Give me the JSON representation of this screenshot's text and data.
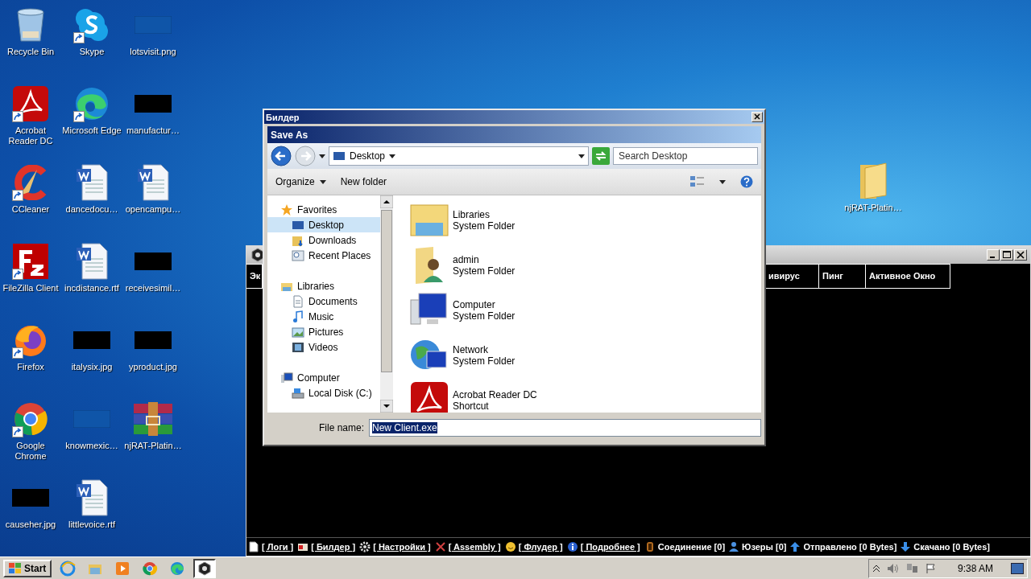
{
  "desktop_icons": [
    {
      "label": "Recycle Bin",
      "kind": "recycle",
      "shortcut": false
    },
    {
      "label": "Skype",
      "kind": "skype",
      "shortcut": true
    },
    {
      "label": "lotsvisit.png",
      "kind": "blank-image",
      "shortcut": false
    },
    {
      "label": "Acrobat Reader DC",
      "kind": "acrobat",
      "shortcut": true
    },
    {
      "label": "Microsoft Edge",
      "kind": "edge",
      "shortcut": true
    },
    {
      "label": "manufactur…",
      "kind": "dark-image",
      "shortcut": false
    },
    {
      "label": "CCleaner",
      "kind": "ccleaner",
      "shortcut": true
    },
    {
      "label": "dancedocu…",
      "kind": "word",
      "shortcut": false
    },
    {
      "label": "opencampu…",
      "kind": "word",
      "shortcut": false
    },
    {
      "label": "FileZilla Client",
      "kind": "filezilla",
      "shortcut": true
    },
    {
      "label": "incdistance.rtf",
      "kind": "word",
      "shortcut": false
    },
    {
      "label": "receivesimil…",
      "kind": "dark-image",
      "shortcut": false
    },
    {
      "label": "Firefox",
      "kind": "firefox",
      "shortcut": true
    },
    {
      "label": "italysix.jpg",
      "kind": "dark-image",
      "shortcut": false
    },
    {
      "label": "yproduct.jpg",
      "kind": "dark-image",
      "shortcut": false
    },
    {
      "label": "Google Chrome",
      "kind": "chrome",
      "shortcut": true
    },
    {
      "label": "knowmexic…",
      "kind": "blank-image",
      "shortcut": false
    },
    {
      "label": "njRAT-Platin…",
      "kind": "winrar",
      "shortcut": false
    },
    {
      "label": "causeher.jpg",
      "kind": "dark-image",
      "shortcut": false
    },
    {
      "label": "littlevoice.rtf",
      "kind": "word",
      "shortcut": false
    }
  ],
  "desktop_side_icons": [
    {
      "label": "njRAT-Platin…",
      "kind": "folder",
      "shortcut": false
    }
  ],
  "njrat_window": {
    "columns": [
      "Эк",
      "ивирус",
      "Пинг",
      "Активное Окно"
    ],
    "status_links": [
      {
        "kind": "log",
        "label": "[ Логи ]"
      },
      {
        "kind": "builder",
        "label": "[ Билдер ]"
      },
      {
        "kind": "settings",
        "label": "[ Настройки ]"
      },
      {
        "kind": "assembly",
        "label": "[ Assembly ]"
      },
      {
        "kind": "flooder",
        "label": "[ Флудер ]"
      },
      {
        "kind": "info",
        "label": "[ Подробнее ]"
      }
    ],
    "status_counters": [
      {
        "kind": "connection",
        "label": "Соединение [0]"
      },
      {
        "kind": "users",
        "label": "Юзеры [0]"
      },
      {
        "kind": "upload",
        "label": "Отправлено [0 Bytes]"
      },
      {
        "kind": "download",
        "label": "Скачано [0 Bytes]"
      }
    ]
  },
  "builder_window": {
    "title": "Билдер",
    "save_dialog": {
      "title": "Save As",
      "location": "Desktop",
      "search_placeholder": "Search Desktop",
      "toolbar": [
        {
          "label": "Organize",
          "kind": "menu"
        },
        {
          "label": "New folder",
          "kind": "button"
        }
      ],
      "nav": [
        {
          "label": "Favorites",
          "kind": "favorites",
          "selected": false,
          "children": [
            {
              "label": "Desktop",
              "kind": "desktop",
              "selected": true
            },
            {
              "label": "Downloads",
              "kind": "downloads",
              "selected": false
            },
            {
              "label": "Recent Places",
              "kind": "recent",
              "selected": false
            }
          ]
        },
        {
          "label": "Libraries",
          "kind": "libraries",
          "selected": false,
          "children": [
            {
              "label": "Documents",
              "kind": "documents",
              "selected": false
            },
            {
              "label": "Music",
              "kind": "music",
              "selected": false
            },
            {
              "label": "Pictures",
              "kind": "pictures",
              "selected": false
            },
            {
              "label": "Videos",
              "kind": "videos",
              "selected": false
            }
          ]
        },
        {
          "label": "Computer",
          "kind": "computer",
          "selected": false,
          "children": [
            {
              "label": "Local Disk (C:)",
              "kind": "disk",
              "selected": false
            }
          ]
        }
      ],
      "files": [
        {
          "name": "Libraries",
          "type": "System Folder",
          "kind": "libraries"
        },
        {
          "name": "admin",
          "type": "System Folder",
          "kind": "user"
        },
        {
          "name": "Computer",
          "type": "System Folder",
          "kind": "computer"
        },
        {
          "name": "Network",
          "type": "System Folder",
          "kind": "network"
        },
        {
          "name": "Acrobat Reader DC",
          "type": "Shortcut",
          "kind": "acrobat"
        }
      ],
      "file_name_label": "File name:",
      "file_name": "New Client.exe"
    }
  },
  "taskbar": {
    "start": "Start",
    "apps": [
      {
        "kind": "ie",
        "active": false
      },
      {
        "kind": "explorer",
        "active": false
      },
      {
        "kind": "media",
        "active": false
      },
      {
        "kind": "chrome",
        "active": false
      },
      {
        "kind": "edge",
        "active": false
      },
      {
        "kind": "njrat",
        "active": true
      }
    ],
    "clock": "9:38 AM"
  }
}
